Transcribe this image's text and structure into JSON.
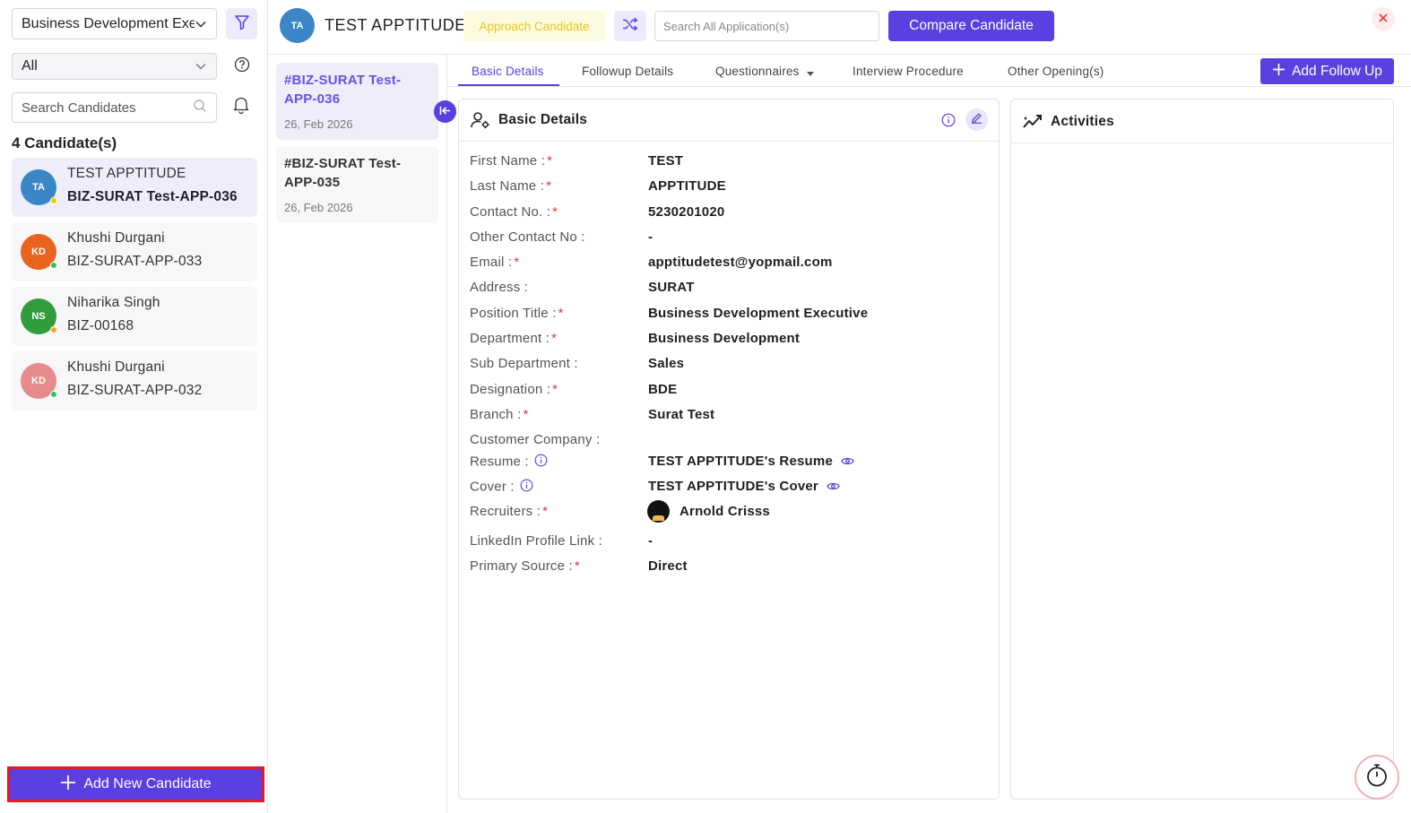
{
  "sidebar": {
    "department_select": "Business Development Executive",
    "status_select": "All",
    "search_placeholder": "Search Candidates",
    "candidate_count": "4 Candidate(s)",
    "candidates": [
      {
        "initials": "TA",
        "name": "TEST APPTITUDE",
        "code": "BIZ-SURAT Test-APP-036",
        "avatar_color": "#3a86c6",
        "status_color": "#f5c400"
      },
      {
        "initials": "KD",
        "name": "Khushi Durgani",
        "code": "BIZ-SURAT-APP-033",
        "avatar_color": "#e8641f",
        "status_color": "#2fc15a"
      },
      {
        "initials": "NS",
        "name": "Niharika Singh",
        "code": "BIZ-00168",
        "avatar_color": "#2f9d3e",
        "status_color": "#f5a623"
      },
      {
        "initials": "KD",
        "name": "Khushi Durgani",
        "code": "BIZ-SURAT-APP-032",
        "avatar_color": "#e58b8b",
        "status_color": "#2fc15a"
      }
    ],
    "add_new_label": "Add New Candidate"
  },
  "header": {
    "initials": "TA",
    "name": "TEST APPTITUDE",
    "stage_badge": "Approach Candidate",
    "search_placeholder": "Search All Application(s)",
    "compare_label": "Compare Candidate"
  },
  "applications": [
    {
      "title": "#BIZ-SURAT Test-APP-036",
      "date": "26, Feb 2026"
    },
    {
      "title": "#BIZ-SURAT Test-APP-035",
      "date": "26, Feb 2026"
    }
  ],
  "tabs": [
    {
      "label": "Basic Details"
    },
    {
      "label": "Followup Details"
    },
    {
      "label": "Questionnaires"
    },
    {
      "label": "Interview Procedure"
    },
    {
      "label": "Other Opening(s)"
    }
  ],
  "add_follow_up_label": "Add Follow Up",
  "basic_details": {
    "title": "Basic Details",
    "fields": [
      {
        "label": "First Name :",
        "required": true,
        "value": "TEST"
      },
      {
        "label": "Last Name :",
        "required": true,
        "value": "APPTITUDE"
      },
      {
        "label": "Contact No. :",
        "required": true,
        "value": "5230201020"
      },
      {
        "label": "Other Contact No :",
        "required": false,
        "value": "-"
      },
      {
        "label": "Email :",
        "required": true,
        "value": "apptitudetest@yopmail.com"
      },
      {
        "label": "Address :",
        "required": false,
        "value": "SURAT"
      },
      {
        "label": "Position Title :",
        "required": true,
        "value": "Business Development Executive"
      },
      {
        "label": "Department :",
        "required": true,
        "value": "Business Development"
      },
      {
        "label": "Sub Department :",
        "required": false,
        "value": "Sales"
      },
      {
        "label": "Designation :",
        "required": true,
        "value": "BDE"
      },
      {
        "label": "Branch :",
        "required": true,
        "value": "Surat Test"
      },
      {
        "label": "Customer Company :",
        "required": false,
        "value": ""
      },
      {
        "label": "Resume :",
        "required": false,
        "value": "TEST APPTITUDE's Resume"
      },
      {
        "label": "Cover :",
        "required": false,
        "value": "TEST APPTITUDE's Cover"
      },
      {
        "label": "Recruiters :",
        "required": true,
        "value": "Arnold Crisss"
      },
      {
        "label": "LinkedIn Profile Link :",
        "required": false,
        "value": "-"
      },
      {
        "label": "Primary Source :",
        "required": true,
        "value": "Direct"
      }
    ]
  },
  "activities": {
    "title": "Activities"
  },
  "colors": {
    "accent": "#5b3fe0",
    "required": "#e53935",
    "badge_text": "#e6c51f"
  }
}
